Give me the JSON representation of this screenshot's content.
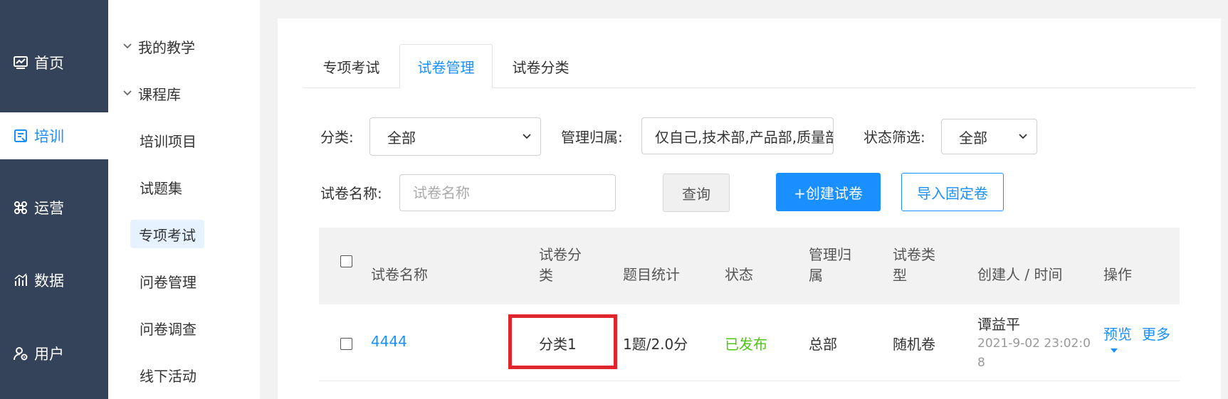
{
  "nav": {
    "items": [
      {
        "label": "首页",
        "icon": "monitor-chart-icon",
        "active": false
      },
      {
        "label": "培训",
        "icon": "book-icon",
        "active": true
      },
      {
        "label": "运营",
        "icon": "command-icon",
        "active": false
      },
      {
        "label": "数据",
        "icon": "bar-chart-icon",
        "active": false
      },
      {
        "label": "用户",
        "icon": "user-settings-icon",
        "active": false
      }
    ]
  },
  "submenu": {
    "groups": [
      {
        "label": "我的教学",
        "expanded": true
      },
      {
        "label": "课程库",
        "expanded": true
      }
    ],
    "items": [
      {
        "label": "培训项目"
      },
      {
        "label": "试题集"
      },
      {
        "label": "专项考试",
        "active": true
      },
      {
        "label": "问卷管理"
      },
      {
        "label": "问卷调查"
      },
      {
        "label": "线下活动"
      }
    ]
  },
  "tabs": [
    {
      "label": "专项考试"
    },
    {
      "label": "试卷管理",
      "active": true
    },
    {
      "label": "试卷分类"
    }
  ],
  "filters": {
    "category_label": "分类:",
    "category_value": "全部",
    "ownership_label": "管理归属:",
    "ownership_value": "仅自己,技术部,产品部,质量部",
    "status_label": "状态筛选:",
    "status_value": "全部",
    "name_label": "试卷名称:",
    "name_placeholder": "试卷名称",
    "query_button": "查询",
    "create_button": "+创建试卷",
    "import_button": "导入固定卷"
  },
  "table": {
    "headers": {
      "name": "试卷名称",
      "category_line1": "试卷分",
      "category_line2": "类",
      "stats": "题目统计",
      "status": "状态",
      "owner_line1": "管理归",
      "owner_line2": "属",
      "type_line1": "试卷类",
      "type_line2": "型",
      "creator": "创建人 / 时间",
      "actions": "操作"
    },
    "rows": [
      {
        "name": "4444",
        "category": "分类1",
        "stats": "1题/2.0分",
        "status": "已发布",
        "owner": "总部",
        "type": "随机卷",
        "creator": "谭益平",
        "time_line1": "2021-9-02 23:02:0",
        "time_line2": "8",
        "action_preview": "预览",
        "action_more": "更多"
      }
    ]
  },
  "colors": {
    "nav_bg": "#344359",
    "accent": "#1a8fff",
    "status_published": "#52c41a",
    "highlight": "#e0262c"
  }
}
